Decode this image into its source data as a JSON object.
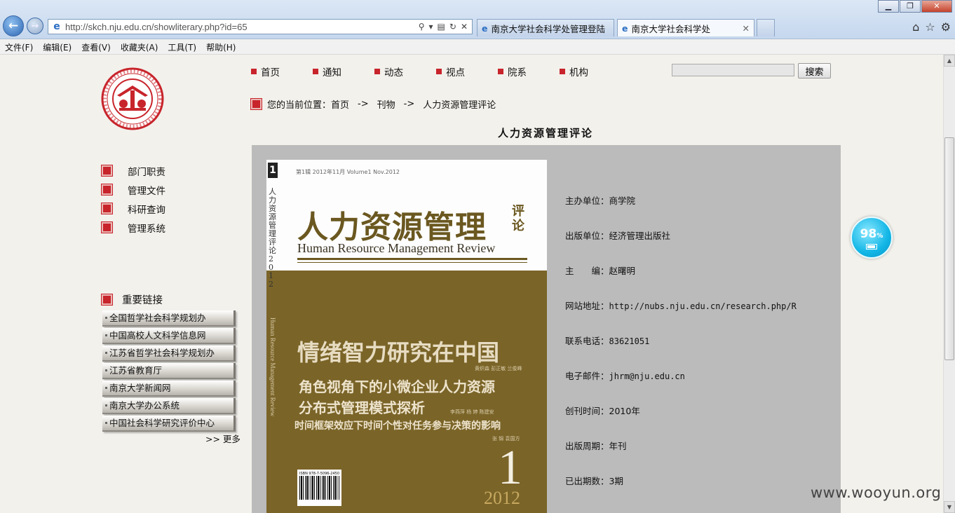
{
  "browser": {
    "window_controls": [
      "▁",
      "❐",
      "✕"
    ],
    "url": "http://skch.nju.edu.cn/showliterary.php?id=65",
    "tabs": [
      {
        "label": "南京大学社会科学处管理登陆",
        "active": false
      },
      {
        "label": "南京大学社会科学处",
        "active": true
      }
    ],
    "menu": [
      "文件(F)",
      "编辑(E)",
      "查看(V)",
      "收藏夹(A)",
      "工具(T)",
      "帮助(H)"
    ]
  },
  "logo": {
    "alt": "南京大学社会科学处"
  },
  "nav": {
    "items": [
      "首页",
      "通知",
      "动态",
      "视点",
      "院系",
      "机构"
    ],
    "search_button": "搜索",
    "search_value": ""
  },
  "breadcrumb": {
    "prefix": "您的当前位置：",
    "items": [
      "首页",
      "->",
      "刊物",
      "->",
      "人力资源管理评论"
    ]
  },
  "page_title": "人力资源管理评论",
  "sidebar": {
    "items": [
      "部门职责",
      "管理文件",
      "科研查询",
      "管理系统"
    ],
    "links_title": "重要链接",
    "links": [
      "全国哲学社会科学规划办",
      "中国高校人文科学信息网",
      "江苏省哲学社会科学规划办",
      "江苏省教育厅",
      "南京大学新闻网",
      "南京大学办公系统",
      "中国社会科学研究评价中心"
    ],
    "more": ">> 更多"
  },
  "cover": {
    "spine_num": "1",
    "spine_title": "人力资源管理评论2012",
    "issue_line": "第1辑 2012年11月 Volume1 Nov.2012",
    "title": "人力资源管理",
    "title_suffix": "评论",
    "english_title": "Human Resource Management Review",
    "english_spine": "Human Resource Management Review",
    "headline1": "情绪智力研究在中国",
    "authors1": "黄织森  彭正敏  兰俊峰",
    "headline2": "角色视角下的小微企业人力资源",
    "headline3": "分布式管理模式探析",
    "authors3": "李燕萍  杨  婷  陈建安",
    "headline4": "时间框架效应下时间个性对任务参与决策的影响",
    "authors4": "张  锦  袁国方",
    "big_number": "1",
    "year": "2012",
    "isbn": "ISBN 978-7-5096-2450-5"
  },
  "info": [
    {
      "label": "主办单位：",
      "value": "商学院",
      "mono": false
    },
    {
      "label": "出版单位：",
      "value": "经济管理出版社",
      "mono": false
    },
    {
      "label": "主　　编：",
      "value": "赵曙明",
      "mono": false
    },
    {
      "label": "网站地址：",
      "value": "http://nubs.nju.edu.cn/research.php/R",
      "mono": true
    },
    {
      "label": "联系电话：",
      "value": "83621051",
      "mono": true
    },
    {
      "label": "电子邮件：",
      "value": "jhrm@nju.edu.cn",
      "mono": true
    },
    {
      "label": "创刊时间：",
      "value": "2010年",
      "mono": false
    },
    {
      "label": "出版周期：",
      "value": "年刊",
      "mono": false
    },
    {
      "label": "已出期数：",
      "value": "3期",
      "mono": false
    }
  ],
  "battery_widget": {
    "percent": "98",
    "unit": "%"
  },
  "watermark": "www.wooyun.org",
  "colors": {
    "accent_red": "#c8242b",
    "cover_brown": "#7a6428",
    "panel_gray": "#bbbbbb",
    "page_bg": "#f3f1ec"
  }
}
